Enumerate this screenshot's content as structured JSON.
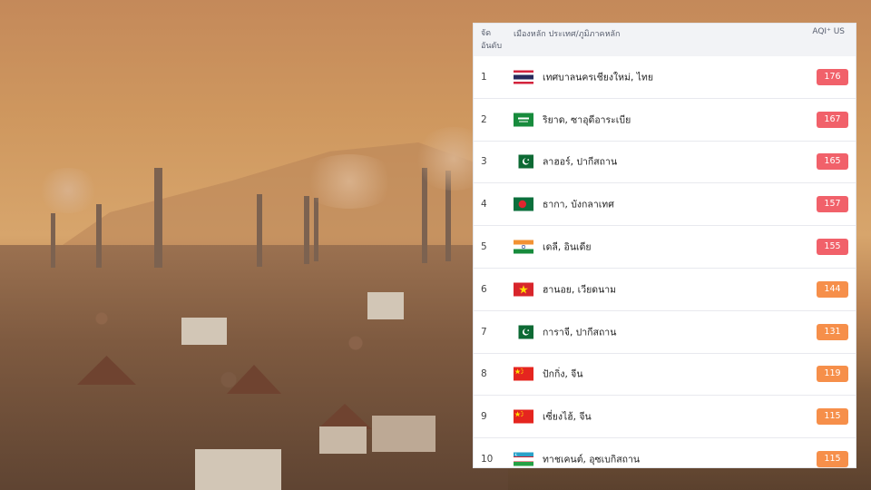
{
  "ranking_table": {
    "header": {
      "rank": "จัดอันดับ",
      "city": "เมืองหลัก ประเทศ/ภูมิภาคหลัก",
      "aqi": "AQI⁺ US"
    },
    "rows": [
      {
        "rank": "1",
        "flag": "thailand-flag",
        "city": "เทศบาลนครเชียงใหม่, ไทย",
        "aqi": "176",
        "level_color": "#f1616a"
      },
      {
        "rank": "2",
        "flag": "saudi-arabia-flag",
        "city": "ริยาด, ซาอุดีอาระเบีย",
        "aqi": "167",
        "level_color": "#f1616a"
      },
      {
        "rank": "3",
        "flag": "pakistan-flag",
        "city": "ลาฮอร์, ปากีสถาน",
        "aqi": "165",
        "level_color": "#f1616a"
      },
      {
        "rank": "4",
        "flag": "bangladesh-flag",
        "city": "ธากา, บังกลาเทศ",
        "aqi": "157",
        "level_color": "#f1616a"
      },
      {
        "rank": "5",
        "flag": "india-flag",
        "city": "เดลี, อินเดีย",
        "aqi": "155",
        "level_color": "#f1616a"
      },
      {
        "rank": "6",
        "flag": "vietnam-flag",
        "city": "ฮานอย, เวียดนาม",
        "aqi": "144",
        "level_color": "#f68f4a"
      },
      {
        "rank": "7",
        "flag": "pakistan-flag",
        "city": "การาจี, ปากีสถาน",
        "aqi": "131",
        "level_color": "#f68f4a"
      },
      {
        "rank": "8",
        "flag": "china-flag",
        "city": "ปักกิ่ง, จีน",
        "aqi": "119",
        "level_color": "#f68f4a"
      },
      {
        "rank": "9",
        "flag": "china-flag",
        "city": "เซี่ยงไฮ้, จีน",
        "aqi": "115",
        "level_color": "#f68f4a"
      },
      {
        "rank": "10",
        "flag": "uzbekistan-flag",
        "city": "ทาชเคนต์, อุซเบกิสถาน",
        "aqi": "115",
        "level_color": "#f68f4a"
      }
    ]
  }
}
